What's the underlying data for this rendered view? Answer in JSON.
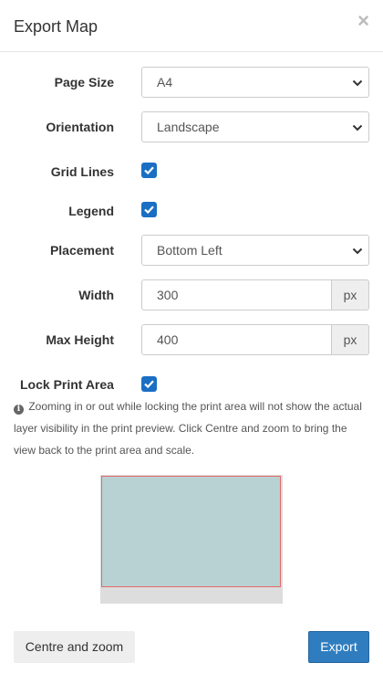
{
  "dialog": {
    "title": "Export Map",
    "close_symbol": "×"
  },
  "form": {
    "page_size": {
      "label": "Page Size",
      "value": "A4"
    },
    "orientation": {
      "label": "Orientation",
      "value": "Landscape"
    },
    "grid_lines": {
      "label": "Grid Lines",
      "checked": true
    },
    "legend": {
      "label": "Legend",
      "checked": true
    },
    "placement": {
      "label": "Placement",
      "value": "Bottom Left"
    },
    "width": {
      "label": "Width",
      "value": "300",
      "unit": "px"
    },
    "max_height": {
      "label": "Max Height",
      "value": "400",
      "unit": "px"
    },
    "lock_print_area": {
      "label": "Lock Print Area",
      "checked": true
    }
  },
  "info": {
    "icon": "info-circle-icon",
    "text": "Zooming in or out while locking the print area will not show the actual layer visibility in the print preview. Click Centre and zoom to bring the view back to the print area and scale."
  },
  "preview": {
    "map_color": "#b8d1d3",
    "frame_color": "#e46a6a"
  },
  "footer": {
    "centre_zoom_label": "Centre and zoom",
    "export_label": "Export"
  },
  "colors": {
    "primary": "#2f7dbf",
    "checkbox": "#1a6fc4"
  }
}
